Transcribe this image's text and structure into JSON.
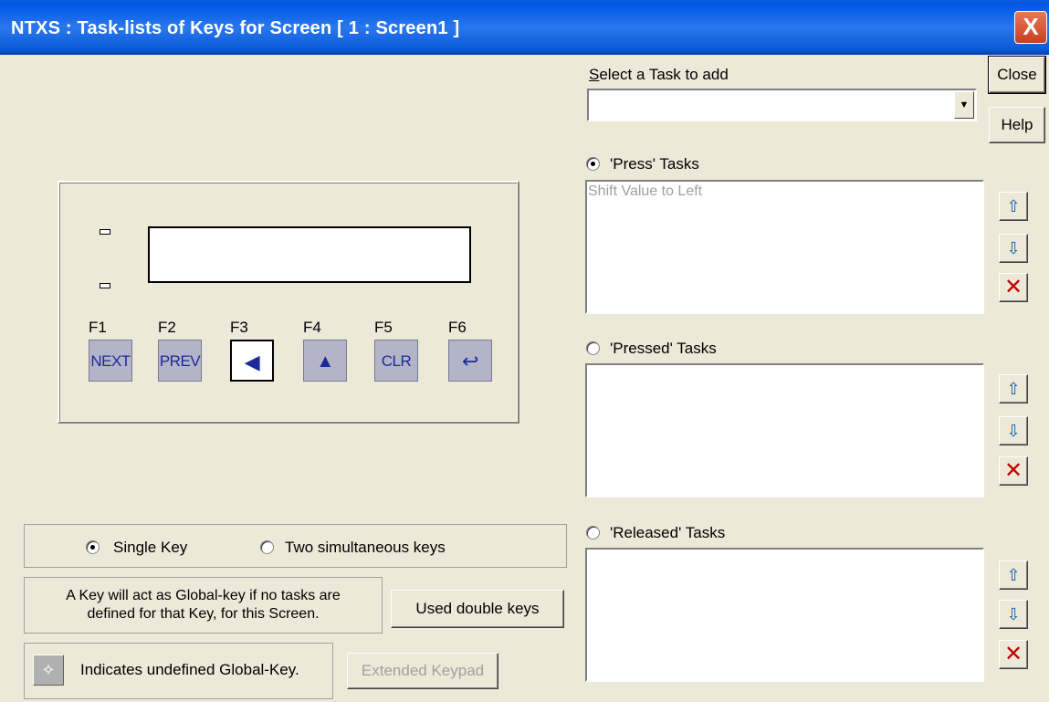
{
  "window": {
    "title": "NTXS : Task-lists of Keys for Screen [ 1 : Screen1 ]",
    "close_glyph": "X"
  },
  "keypad": {
    "keys": [
      {
        "fn": "F1",
        "label": "NEXT",
        "icon": null
      },
      {
        "fn": "F2",
        "label": "PREV",
        "icon": null
      },
      {
        "fn": "F3",
        "label": "◀",
        "icon": "left-triangle-icon",
        "selected": true
      },
      {
        "fn": "F4",
        "label": "▲",
        "icon": "up-triangle-icon"
      },
      {
        "fn": "F5",
        "label": "CLR",
        "icon": null
      },
      {
        "fn": "F6",
        "label": "↩",
        "icon": "enter-return-icon"
      }
    ]
  },
  "task_select": {
    "label": "Select a Task to add",
    "mnemonic": "S",
    "value": ""
  },
  "buttons": {
    "close": "Close",
    "help": "Help",
    "used_double_keys": "Used double keys",
    "extended_keypad": "Extended Keypad"
  },
  "task_lists": [
    {
      "label": "'Press' Tasks",
      "selected": true,
      "items": [
        "Shift Value to Left"
      ]
    },
    {
      "label": "'Pressed' Tasks",
      "selected": false,
      "items": []
    },
    {
      "label": "'Released' Tasks",
      "selected": false,
      "items": []
    }
  ],
  "key_mode": {
    "single": "Single Key",
    "double": "Two simultaneous keys",
    "selected": "single"
  },
  "notes": {
    "global_key_line1": "A Key will act as Global-key if no tasks are",
    "global_key_line2": "defined for that Key, for this Screen.",
    "undefined_global": "Indicates undefined Global-Key."
  },
  "colors": {
    "title_bar": "#0a5ad8",
    "face": "#ece9d8",
    "key_face": "#b4b4c8",
    "key_text": "#1a2a9a",
    "close_red": "#c8401e"
  }
}
